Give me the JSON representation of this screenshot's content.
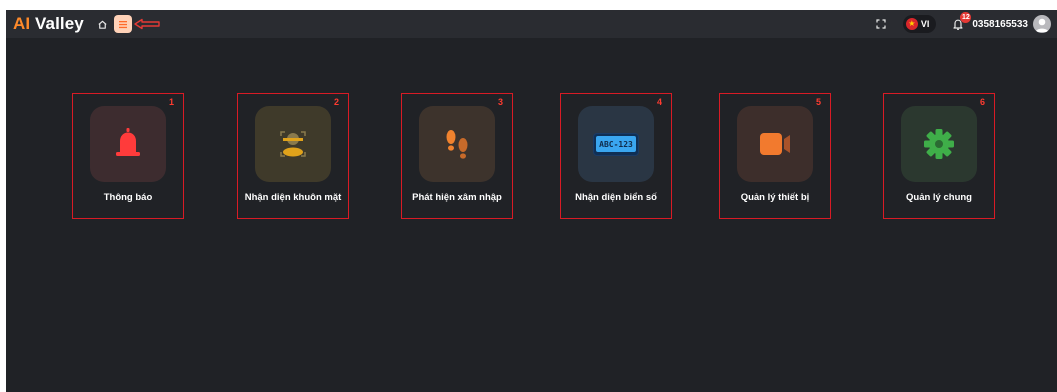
{
  "header": {
    "brand_ai": "AI",
    "brand_rest": " Valley",
    "language": "VI",
    "notification_count": "12",
    "user_phone": "0358165533"
  },
  "icons": {
    "home": "home-icon",
    "menu": "menu-icon",
    "arrow": "arrow-left-icon",
    "fullscreen": "fullscreen-icon",
    "flag": "vietnam-flag-icon",
    "bell": "bell-icon",
    "avatar": "user-avatar-icon"
  },
  "tiles": [
    {
      "number": "1",
      "label": "Thông báo",
      "icon": "alarm-bell-icon",
      "bg": "#3d2c2f",
      "accent": "#ff3b3b"
    },
    {
      "number": "2",
      "label": "Nhận diện khuôn mặt",
      "icon": "face-recognition-icon",
      "bg": "#3f3a2a",
      "accent": "#e0a21b"
    },
    {
      "number": "3",
      "label": "Phát hiện xâm nhập",
      "icon": "footprints-icon",
      "bg": "#3d332c",
      "accent": "#f0822e"
    },
    {
      "number": "4",
      "label": "Nhận diện biển số",
      "icon": "license-plate-icon",
      "bg": "#2a3644",
      "accent": "#3aa6f0",
      "plate_text": "ABC-123"
    },
    {
      "number": "5",
      "label": "Quản lý thiết bị",
      "icon": "video-camera-icon",
      "bg": "#3d2e2b",
      "accent": "#f27a2e"
    },
    {
      "number": "6",
      "label": "Quản lý chung",
      "icon": "gear-icon",
      "bg": "#2b382f",
      "accent": "#3fae49"
    }
  ]
}
